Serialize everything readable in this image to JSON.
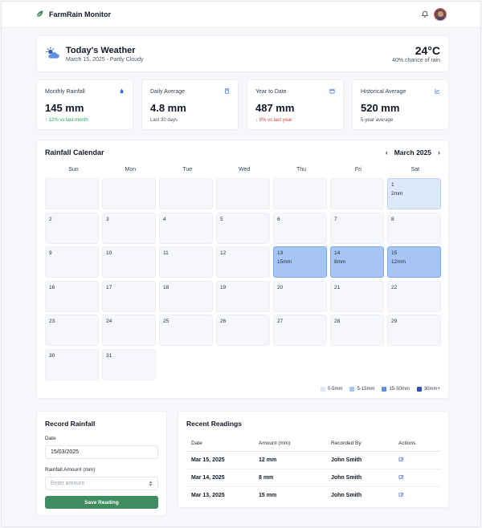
{
  "app": {
    "name": "FarmRain Monitor",
    "logo_icon": "leaf-icon"
  },
  "colors": {
    "accent_green": "#3f8c60",
    "up": "#22a35a",
    "down": "#e23d3d",
    "legend_1": "#dde8f8",
    "legend_2": "#a7c5f4",
    "legend_3": "#5f8fe6",
    "legend_4": "#2e4fb8"
  },
  "weather": {
    "title": "Today's Weather",
    "subtitle": "March 15, 2025 - Partly Cloudy",
    "temperature": "24°C",
    "rain_chance": "40% chance of rain",
    "icon": "partly-cloudy-icon"
  },
  "stats": [
    {
      "label": "Monthly Rainfall",
      "value": "145 mm",
      "note": "↑ 12% vs last month",
      "trend": "up",
      "icon": "droplet-icon"
    },
    {
      "label": "Daily Average",
      "value": "4.8 mm",
      "note": "Last 30 days",
      "trend": "none",
      "icon": "calculator-icon"
    },
    {
      "label": "Year to Date",
      "value": "487 mm",
      "note": "↓ 8% vs last year",
      "trend": "down",
      "icon": "calendar-icon"
    },
    {
      "label": "Historical Average",
      "value": "520 mm",
      "note": "5-year average",
      "trend": "none",
      "icon": "line-chart-icon"
    }
  ],
  "calendar": {
    "title": "Rainfall Calendar",
    "month_label": "March 2025",
    "prev": "‹",
    "next": "›",
    "weekdays": [
      "Sun",
      "Mon",
      "Tue",
      "Wed",
      "Thu",
      "Fri",
      "Sat"
    ],
    "leading_blanks": 6,
    "days": [
      {
        "day": "1",
        "amount": "2mm",
        "level": 1
      },
      {
        "day": "2"
      },
      {
        "day": "3"
      },
      {
        "day": "4"
      },
      {
        "day": "5"
      },
      {
        "day": "6"
      },
      {
        "day": "7"
      },
      {
        "day": "8"
      },
      {
        "day": "9"
      },
      {
        "day": "10"
      },
      {
        "day": "11"
      },
      {
        "day": "12"
      },
      {
        "day": "13",
        "amount": "15mm",
        "level": 2
      },
      {
        "day": "14",
        "amount": "8mm",
        "level": 2
      },
      {
        "day": "15",
        "amount": "12mm",
        "level": 2
      },
      {
        "day": "16"
      },
      {
        "day": "17"
      },
      {
        "day": "18"
      },
      {
        "day": "19"
      },
      {
        "day": "20"
      },
      {
        "day": "21"
      },
      {
        "day": "22"
      },
      {
        "day": "23"
      },
      {
        "day": "24"
      },
      {
        "day": "25"
      },
      {
        "day": "26"
      },
      {
        "day": "27"
      },
      {
        "day": "28"
      },
      {
        "day": "29"
      },
      {
        "day": "30"
      },
      {
        "day": "31"
      }
    ],
    "legend": [
      {
        "label": "0-5mm",
        "color": "#dde8f8"
      },
      {
        "label": "5-15mm",
        "color": "#a7c5f4"
      },
      {
        "label": "15-30mm",
        "color": "#5f8fe6"
      },
      {
        "label": "30mm+",
        "color": "#2e4fb8"
      }
    ]
  },
  "record": {
    "title": "Record Rainfall",
    "date_label": "Date",
    "date_value": "15/03/2025",
    "amount_label": "Rainfall Amount (mm)",
    "amount_placeholder": "Enter amount",
    "save_label": "Save Reading"
  },
  "recent": {
    "title": "Recent Readings",
    "columns": [
      "Date",
      "Amount (mm)",
      "Recorded By",
      "Actions"
    ],
    "rows": [
      {
        "date": "Mar 15, 2025",
        "amount": "12 mm",
        "by": "John Smith"
      },
      {
        "date": "Mar 14, 2025",
        "amount": "8 mm",
        "by": "John Smith"
      },
      {
        "date": "Mar 13, 2025",
        "amount": "15 mm",
        "by": "John Smith"
      }
    ]
  }
}
